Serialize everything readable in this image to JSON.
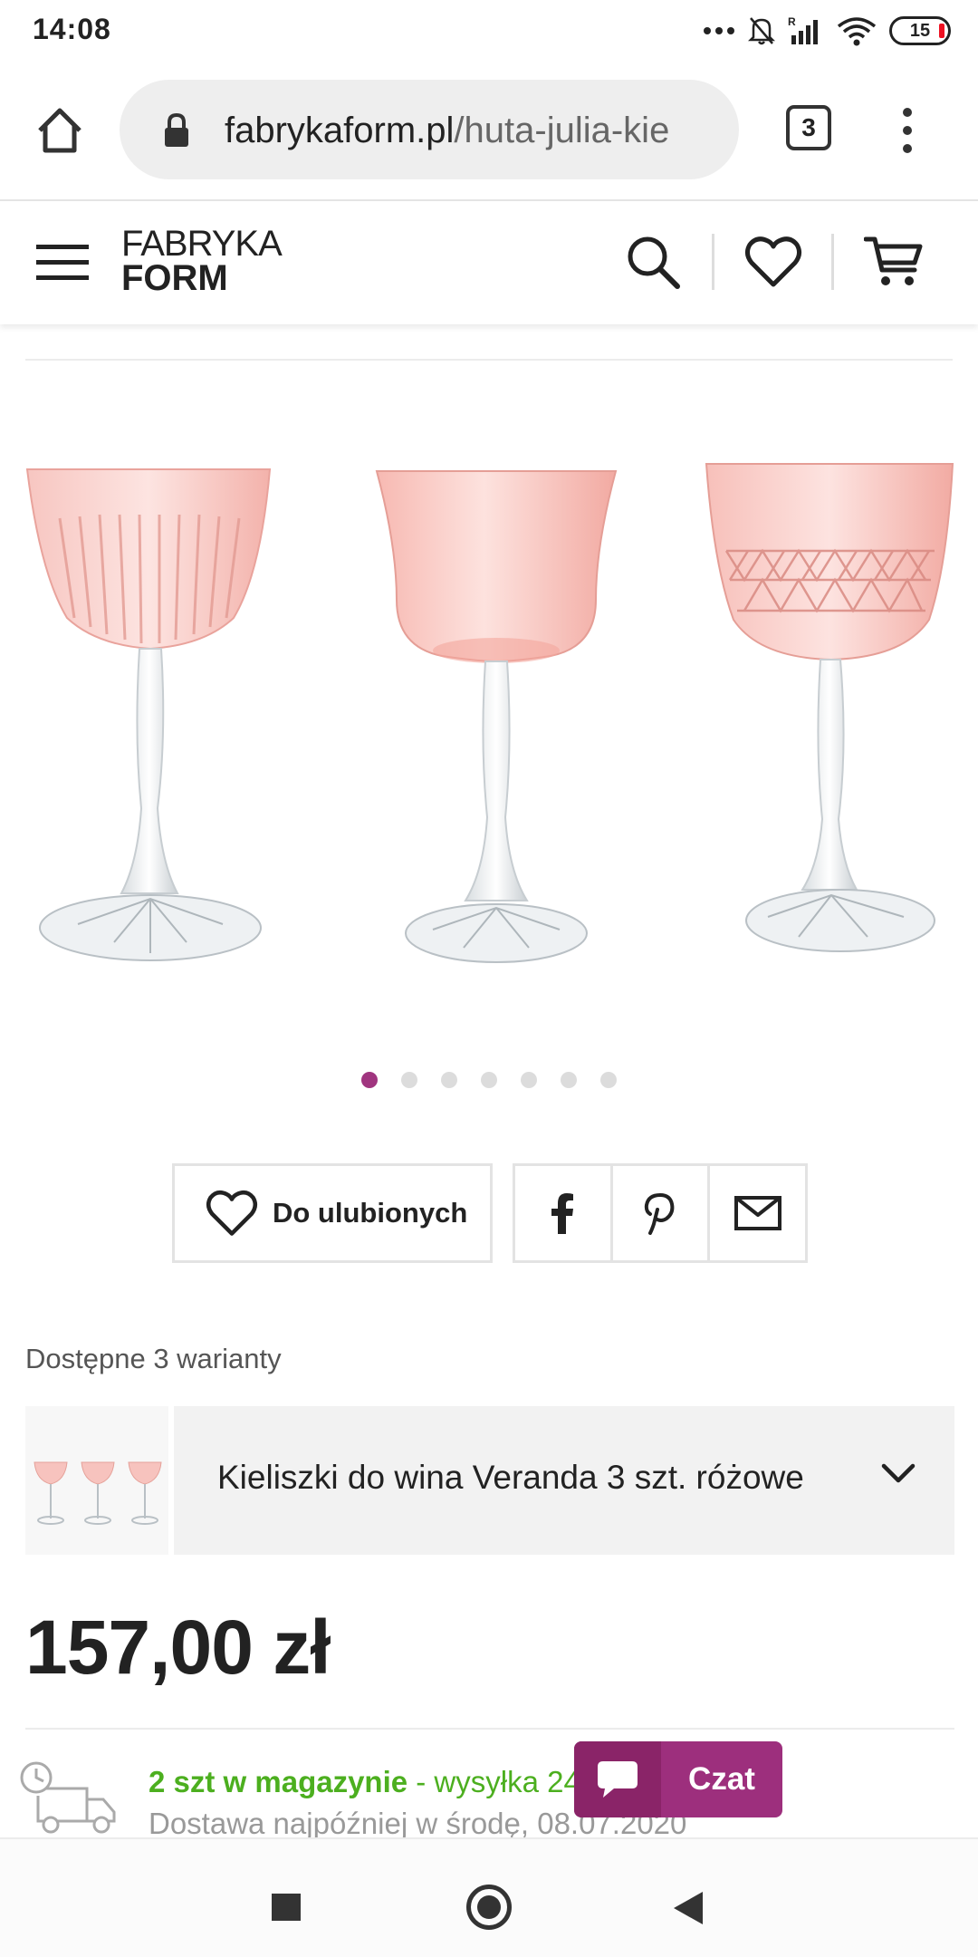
{
  "status_bar": {
    "time": "14:08",
    "battery": "15",
    "icons": [
      "more-dots-icon",
      "bell-off-icon",
      "signal-roaming-icon",
      "wifi-icon",
      "battery-icon"
    ]
  },
  "browser": {
    "url_host": "fabrykaform.pl",
    "url_path": "/huta-julia-kie",
    "tab_count": "3"
  },
  "site_header": {
    "logo_line1": "FABRYKA",
    "logo_line2": "FORM"
  },
  "gallery": {
    "dot_count": 7,
    "active_dot": 0,
    "glass_color": "#f4b3ae"
  },
  "actions": {
    "favorite_label": "Do ulubionych",
    "share_items": [
      "facebook-icon",
      "pinterest-icon",
      "mail-icon"
    ]
  },
  "variants": {
    "label": "Dostępne 3 warianty",
    "selected": "Kieliszki do wina Veranda 3 szt. różowe"
  },
  "price": "157,00 zł",
  "stock": {
    "qty": "2 szt w magazynie",
    "shipping": " - wysyłka 24",
    "delivery": "Dostawa najpóźniej w środę, 08.07.2020"
  },
  "chat": {
    "label": "Czat"
  },
  "colors": {
    "accent": "#9d2f7d",
    "stock_green": "#4caf1f"
  }
}
